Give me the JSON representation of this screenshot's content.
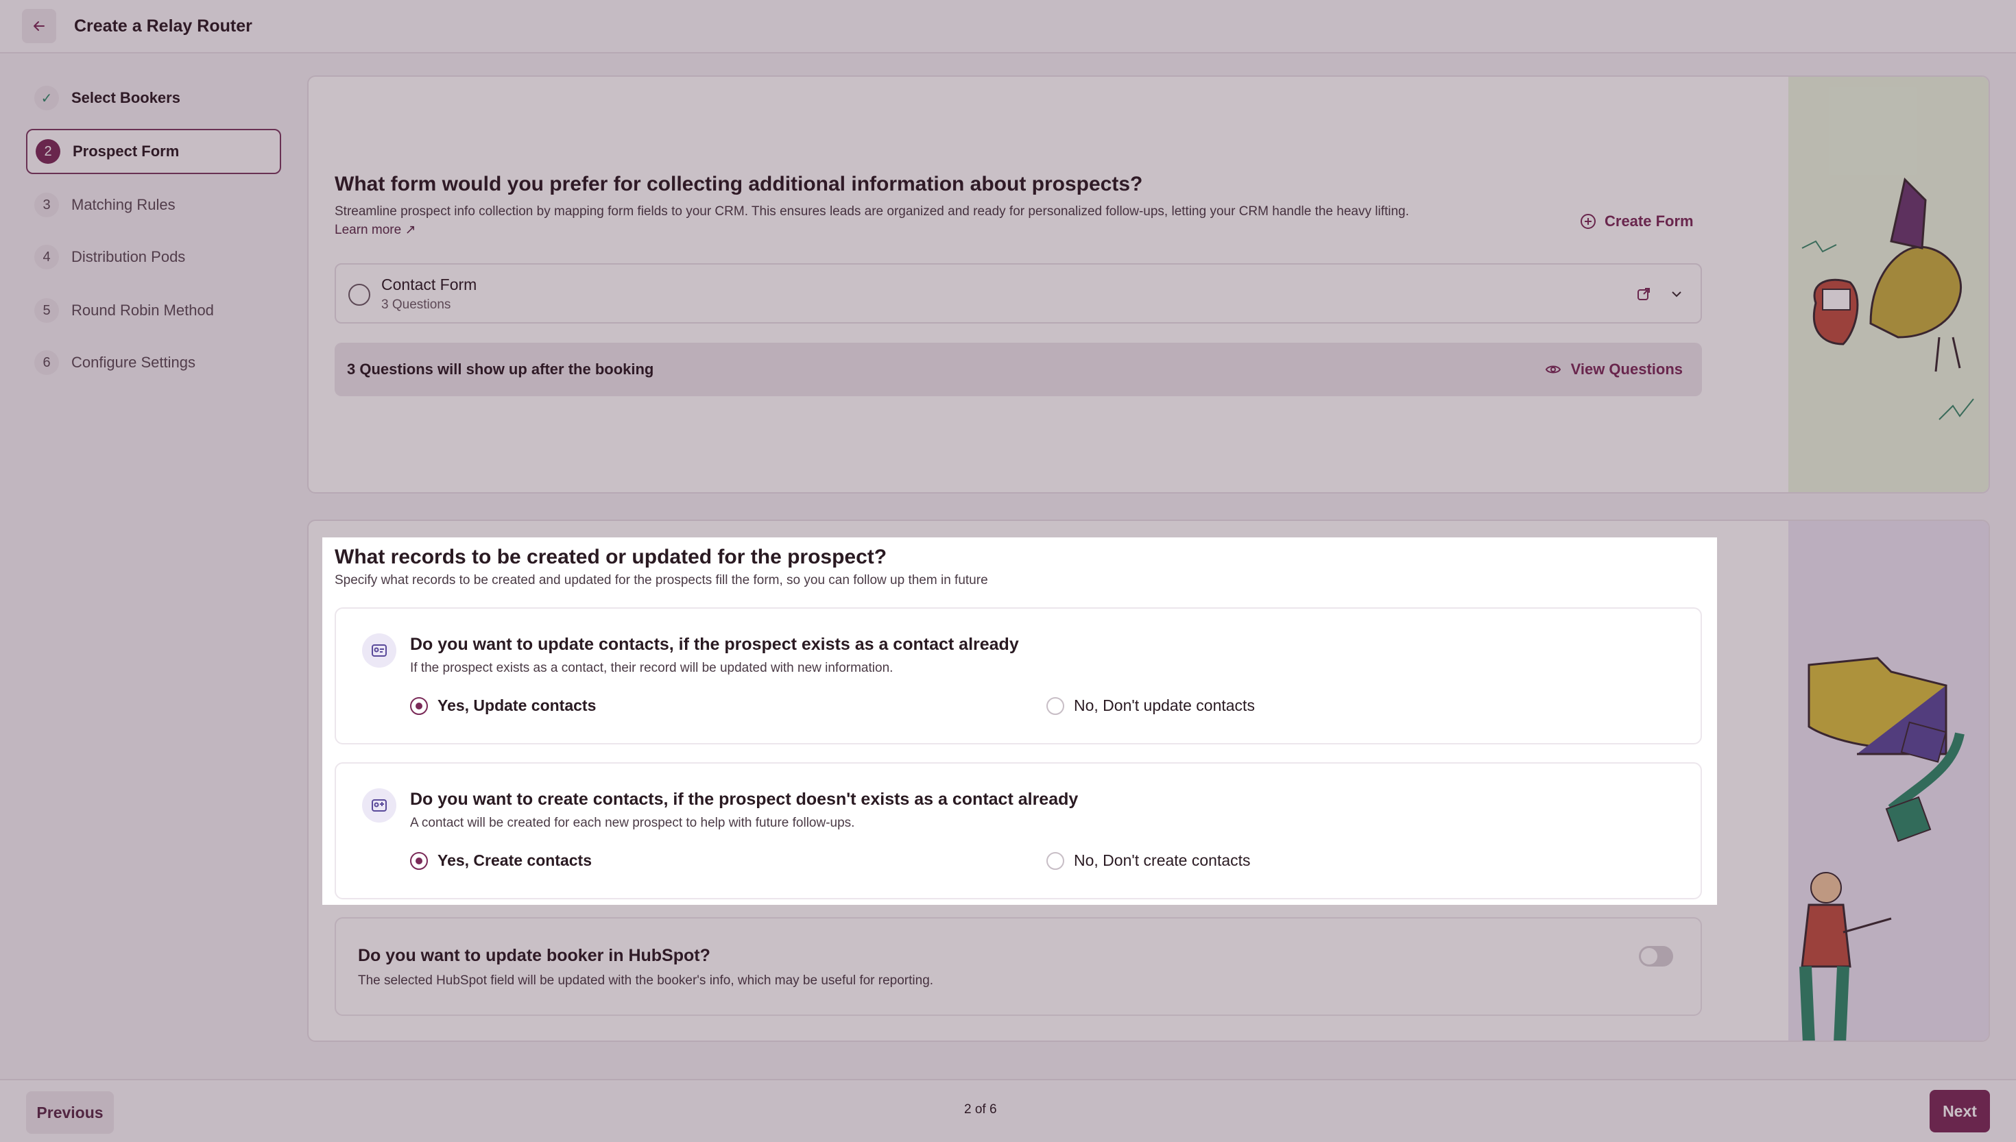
{
  "header": {
    "title": "Create a Relay Router"
  },
  "steps": [
    {
      "num": "✓",
      "label": "Select Bookers",
      "state": "done"
    },
    {
      "num": "2",
      "label": "Prospect Form",
      "state": "active"
    },
    {
      "num": "3",
      "label": "Matching Rules",
      "state": "pending"
    },
    {
      "num": "4",
      "label": "Distribution Pods",
      "state": "pending"
    },
    {
      "num": "5",
      "label": "Round Robin Method",
      "state": "pending"
    },
    {
      "num": "6",
      "label": "Configure Settings",
      "state": "pending"
    }
  ],
  "form_section": {
    "title": "What form would you prefer for collecting additional information about prospects?",
    "subtitle": "Streamline prospect info collection by mapping form fields to your CRM. This ensures leads are organized and ready for personalized follow-ups, letting your CRM handle the heavy lifting.",
    "learn_more": "Learn more ↗",
    "create_form": "Create Form",
    "selected_form": {
      "name": "Contact Form",
      "meta": "3 Questions"
    },
    "questions_note": "3 Questions will show up after the booking",
    "view_questions": "View Questions"
  },
  "records_section": {
    "title": "What records to be created or updated for the prospect?",
    "subtitle": "Specify what records to be created and updated for the prospects fill the form, so you can follow up them in future",
    "update_card": {
      "title": "Do you want to update contacts, if the prospect exists as a contact already",
      "subtitle": "If the prospect exists as a contact, their record will be updated with new information.",
      "yes": "Yes, Update contacts",
      "no": "No, Don't update contacts",
      "selected": "yes"
    },
    "create_card": {
      "title": "Do you want to create contacts, if the prospect doesn't exists as a contact already",
      "subtitle": "A contact will be created for each new prospect to help with future follow-ups.",
      "yes": "Yes, Create contacts",
      "no": "No, Don't create contacts",
      "selected": "yes"
    },
    "booker_card": {
      "title": "Do you want to update booker in HubSpot?",
      "subtitle": "The selected HubSpot field will be updated with the booker's info, which may be useful for reporting.",
      "enabled": false
    }
  },
  "footer": {
    "previous": "Previous",
    "next": "Next",
    "page": "2 of 6"
  },
  "colors": {
    "accent": "#7a2a58",
    "illustration_green": "#eaf6e0",
    "illustration_purple": "#ece6f4"
  }
}
